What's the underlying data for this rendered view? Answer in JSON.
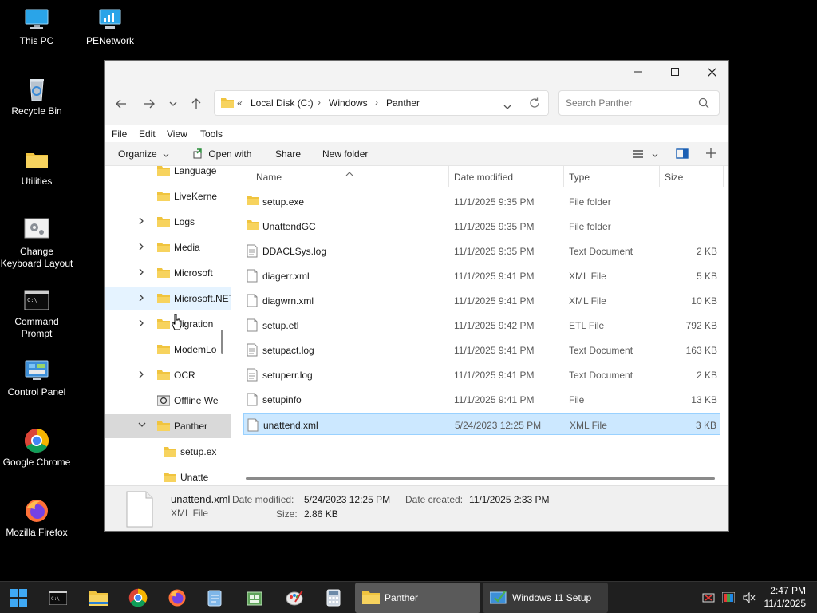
{
  "desktop": {
    "icons": [
      {
        "label": "This PC",
        "icon": "monitor-icon"
      },
      {
        "label": "PENetwork",
        "icon": "network-icon"
      },
      {
        "label": "Recycle Bin",
        "icon": "recycle-bin-icon"
      },
      {
        "label": "Utilities",
        "icon": "folder-icon"
      },
      {
        "label": "Change Keyboard Layout",
        "icon": "keyboard-settings-icon"
      },
      {
        "label": "Command Prompt",
        "icon": "command-prompt-icon"
      },
      {
        "label": "Control Panel",
        "icon": "control-panel-icon"
      },
      {
        "label": "Google Chrome",
        "icon": "chrome-icon"
      },
      {
        "label": "Mozilla Firefox",
        "icon": "firefox-icon"
      }
    ]
  },
  "window": {
    "address": {
      "root_marker": "«",
      "crumbs": [
        "Local Disk (C:)",
        "Windows",
        "Panther"
      ],
      "separator": "›"
    },
    "search": {
      "placeholder": "Search Panther"
    },
    "menu": [
      "File",
      "Edit",
      "View",
      "Tools"
    ],
    "toolbar": {
      "organize": "Organize",
      "open_with": "Open with",
      "share": "Share",
      "new_folder": "New folder"
    },
    "nav_items": [
      {
        "label": "Language",
        "has_chevron": false,
        "expanded": false,
        "selected": false,
        "hover": false
      },
      {
        "label": "LiveKerne",
        "has_chevron": false,
        "expanded": false,
        "selected": false,
        "hover": false
      },
      {
        "label": "Logs",
        "has_chevron": true,
        "expanded": false,
        "selected": false,
        "hover": false
      },
      {
        "label": "Media",
        "has_chevron": true,
        "expanded": false,
        "selected": false,
        "hover": false
      },
      {
        "label": "Microsoft",
        "has_chevron": true,
        "expanded": false,
        "selected": false,
        "hover": false
      },
      {
        "label": "Microsoft.NET",
        "has_chevron": true,
        "expanded": false,
        "selected": false,
        "hover": true
      },
      {
        "label": "Migration",
        "has_chevron": true,
        "expanded": false,
        "selected": false,
        "hover": false
      },
      {
        "label": "ModemLo",
        "has_chevron": false,
        "expanded": false,
        "selected": false,
        "hover": false
      },
      {
        "label": "OCR",
        "has_chevron": true,
        "expanded": false,
        "selected": false,
        "hover": false
      },
      {
        "label": "Offline We",
        "has_chevron": false,
        "expanded": false,
        "selected": false,
        "hover": false
      },
      {
        "label": "Panther",
        "has_chevron": true,
        "expanded": true,
        "selected": true,
        "hover": false
      },
      {
        "label": "setup.ex",
        "has_chevron": false,
        "expanded": false,
        "selected": false,
        "hover": false
      },
      {
        "label": "Unatte",
        "has_chevron": false,
        "expanded": false,
        "selected": false,
        "hover": false
      }
    ],
    "columns": {
      "name": "Name",
      "date": "Date modified",
      "type": "Type",
      "size": "Size"
    },
    "files": [
      {
        "name": "setup.exe",
        "date": "11/1/2025 9:35 PM",
        "type": "File folder",
        "size": "",
        "kind": "folder",
        "selected": false
      },
      {
        "name": "UnattendGC",
        "date": "11/1/2025 9:35 PM",
        "type": "File folder",
        "size": "",
        "kind": "folder",
        "selected": false
      },
      {
        "name": "DDACLSys.log",
        "date": "11/1/2025 9:35 PM",
        "type": "Text Document",
        "size": "2 KB",
        "kind": "text",
        "selected": false
      },
      {
        "name": "diagerr.xml",
        "date": "11/1/2025 9:41 PM",
        "type": "XML File",
        "size": "5 KB",
        "kind": "file",
        "selected": false
      },
      {
        "name": "diagwrn.xml",
        "date": "11/1/2025 9:41 PM",
        "type": "XML File",
        "size": "10 KB",
        "kind": "file",
        "selected": false
      },
      {
        "name": "setup.etl",
        "date": "11/1/2025 9:42 PM",
        "type": "ETL File",
        "size": "792 KB",
        "kind": "file",
        "selected": false
      },
      {
        "name": "setupact.log",
        "date": "11/1/2025 9:41 PM",
        "type": "Text Document",
        "size": "163 KB",
        "kind": "text",
        "selected": false
      },
      {
        "name": "setuperr.log",
        "date": "11/1/2025 9:41 PM",
        "type": "Text Document",
        "size": "2 KB",
        "kind": "text",
        "selected": false
      },
      {
        "name": "setupinfo",
        "date": "11/1/2025 9:41 PM",
        "type": "File",
        "size": "13 KB",
        "kind": "file",
        "selected": false
      },
      {
        "name": "unattend.xml",
        "date": "5/24/2023 12:25 PM",
        "type": "XML File",
        "size": "3 KB",
        "kind": "file",
        "selected": true
      }
    ],
    "details": {
      "filename": "unattend.xml",
      "filetype": "XML File",
      "date_modified_label": "Date modified:",
      "date_modified": "5/24/2023 12:25 PM",
      "size_label": "Size:",
      "size": "2.86 KB",
      "date_created_label": "Date created:",
      "date_created": "11/1/2025 2:33 PM"
    }
  },
  "taskbar": {
    "pinned": [
      "start-icon",
      "command-prompt-icon",
      "file-explorer-icon",
      "chrome-icon",
      "firefox-icon",
      "notepad-icon",
      "registry-icon",
      "paint-icon",
      "calculator-icon"
    ],
    "tasks": [
      {
        "label": "Panther",
        "icon": "folder-icon",
        "active": true
      },
      {
        "label": "Windows 11 Setup",
        "icon": "setup-icon",
        "active": false
      }
    ],
    "clock": {
      "time": "2:47 PM",
      "date": "11/1/2025"
    }
  },
  "colors": {
    "selection": "#cce8ff",
    "selection_border": "#99d1ff",
    "folder": "#f0c43f",
    "taskbar": "#1f1f1f",
    "active_task": "#5a5a5a"
  }
}
